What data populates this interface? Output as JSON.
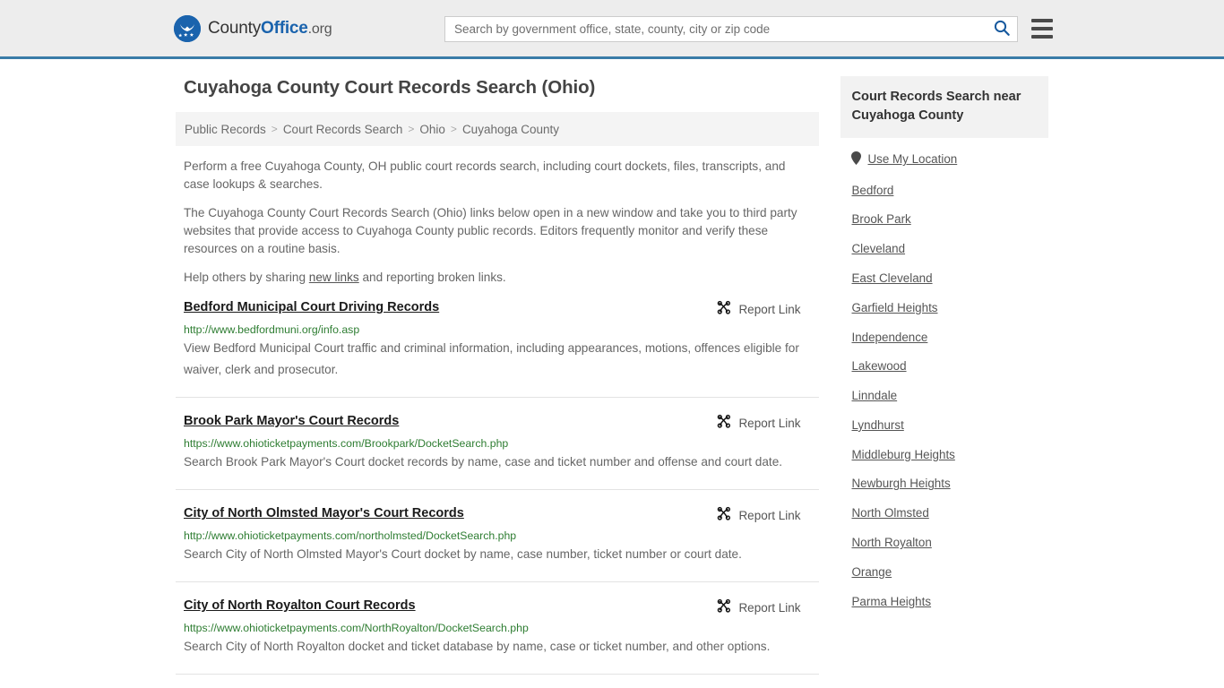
{
  "header": {
    "brand": {
      "part1": "County",
      "part2": "Office",
      "part3": ".org",
      "logo_icon": "eagle-stars-logo"
    },
    "search": {
      "placeholder": "Search by government office, state, county, city or zip code",
      "value": "",
      "search_icon": "search-icon"
    },
    "menu_icon": "hamburger-menu-icon",
    "accent_color": "#3a7ca8"
  },
  "page": {
    "title": "Cuyahoga County Court Records Search (Ohio)"
  },
  "breadcrumb": {
    "items": [
      {
        "label": "Public Records"
      },
      {
        "label": "Court Records Search"
      },
      {
        "label": "Ohio"
      },
      {
        "label": "Cuyahoga County"
      }
    ],
    "separator": ">"
  },
  "intro": {
    "p1": "Perform a free Cuyahoga County, OH public court records search, including court dockets, files, transcripts, and case lookups & searches.",
    "p2": "The Cuyahoga County Court Records Search (Ohio) links below open in a new window and take you to third party websites that provide access to Cuyahoga County public records. Editors frequently monitor and verify these resources on a routine basis.",
    "p3_before": "Help others by sharing ",
    "p3_link": "new links",
    "p3_after": " and reporting broken links."
  },
  "results": {
    "report_label": "Report Link",
    "report_icon": "broken-link-icon",
    "items": [
      {
        "title": "Bedford Municipal Court Driving Records",
        "url": "http://www.bedfordmuni.org/info.asp",
        "description": "View Bedford Municipal Court traffic and criminal information, including appearances, motions, offences eligible for waiver, clerk and prosecutor."
      },
      {
        "title": "Brook Park Mayor's Court Records",
        "url": "https://www.ohioticketpayments.com/Brookpark/DocketSearch.php",
        "description": "Search Brook Park Mayor's Court docket records by name, case and ticket number and offense and court date."
      },
      {
        "title": "City of North Olmsted Mayor's Court Records",
        "url": "http://www.ohioticketpayments.com/northolmsted/DocketSearch.php",
        "description": "Search City of North Olmsted Mayor's Court docket by name, case number, ticket number or court date."
      },
      {
        "title": "City of North Royalton Court Records",
        "url": "https://www.ohioticketpayments.com/NorthRoyalton/DocketSearch.php",
        "description": "Search City of North Royalton docket and ticket database by name, case or ticket number, and other options."
      }
    ]
  },
  "sidebar": {
    "title": "Court Records Search near Cuyahoga County",
    "location_item": {
      "label": "Use My Location",
      "icon": "map-pin-icon"
    },
    "items": [
      {
        "label": "Bedford"
      },
      {
        "label": "Brook Park"
      },
      {
        "label": "Cleveland"
      },
      {
        "label": "East Cleveland"
      },
      {
        "label": "Garfield Heights"
      },
      {
        "label": "Independence"
      },
      {
        "label": "Lakewood"
      },
      {
        "label": "Linndale"
      },
      {
        "label": "Lyndhurst"
      },
      {
        "label": "Middleburg Heights"
      },
      {
        "label": "Newburgh Heights"
      },
      {
        "label": "North Olmsted"
      },
      {
        "label": "North Royalton"
      },
      {
        "label": "Orange"
      },
      {
        "label": "Parma Heights"
      }
    ]
  }
}
